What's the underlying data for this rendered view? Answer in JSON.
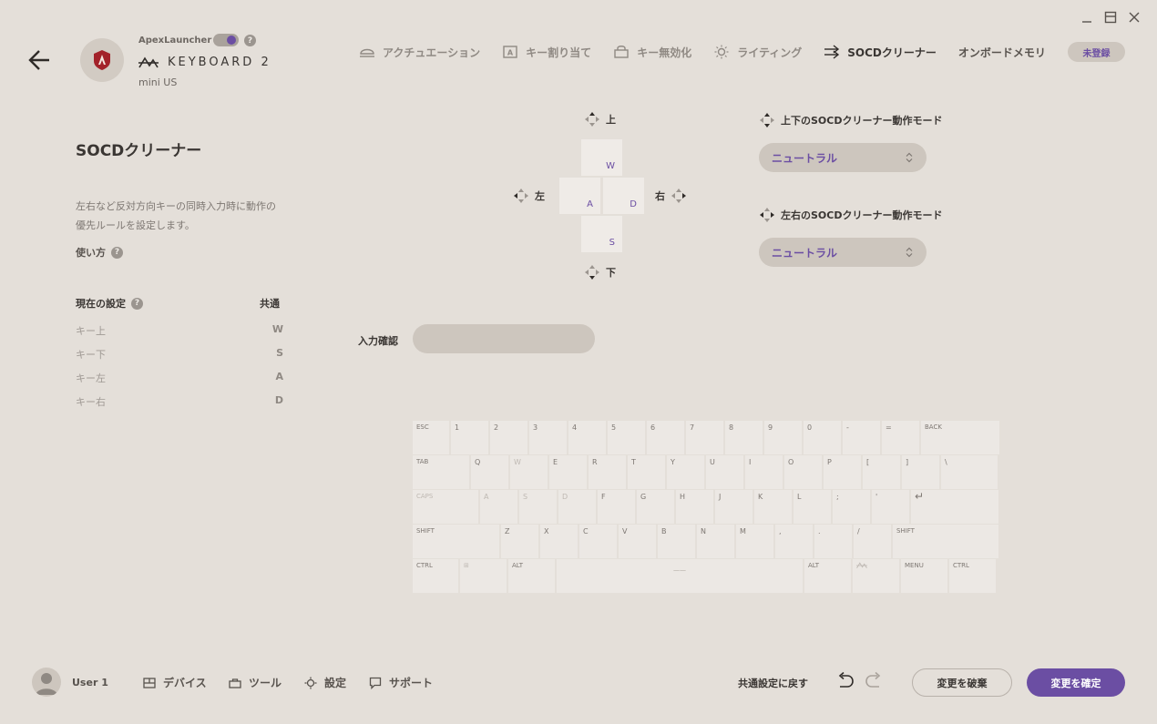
{
  "window": {
    "minimize_icon": "minimize-icon",
    "maximize_icon": "maximize-icon",
    "close_icon": "close-icon"
  },
  "device": {
    "app_name": "ApexLauncher",
    "sync_enabled": true,
    "brand_name": "KEYBOARD 2",
    "model": "mini US"
  },
  "tabs": [
    {
      "label": "アクチュエーション",
      "icon": "actuation-icon"
    },
    {
      "label": "キー割り当て",
      "icon": "key-assign-icon"
    },
    {
      "label": "キー無効化",
      "icon": "key-disable-icon"
    },
    {
      "label": "ライティング",
      "icon": "lighting-icon"
    },
    {
      "label": "SOCDクリーナー",
      "icon": "socd-icon",
      "active": true
    },
    {
      "label": "オンボードメモリ",
      "icon": ""
    }
  ],
  "badge": "未登録",
  "left": {
    "title": "SOCDクリーナー",
    "description": "左右など反対方向キーの同時入力時に動作の優先ルールを設定します。",
    "howto": "使い方",
    "current_title": "現在の設定",
    "current_profile": "共通",
    "settings": [
      {
        "label": "キー上",
        "value": "W"
      },
      {
        "label": "キー下",
        "value": "S"
      },
      {
        "label": "キー左",
        "value": "A"
      },
      {
        "label": "キー右",
        "value": "D"
      }
    ]
  },
  "diagram": {
    "up": "上",
    "down": "下",
    "left": "左",
    "right": "右",
    "keys": {
      "up": "W",
      "left": "A",
      "right": "D",
      "down": "S"
    }
  },
  "modes": {
    "vertical_label": "上下のSOCDクリーナー動作モード",
    "vertical_value": "ニュートラル",
    "horizontal_label": "左右のSOCDクリーナー動作モード",
    "horizontal_value": "ニュートラル"
  },
  "input_confirm": {
    "label": "入力確認",
    "value": ""
  },
  "keyboard": {
    "row1": [
      "ESC",
      "1",
      "2",
      "3",
      "4",
      "5",
      "6",
      "7",
      "8",
      "9",
      "0",
      "-",
      "=",
      "BACK"
    ],
    "row2": [
      "TAB",
      "Q",
      "W",
      "E",
      "R",
      "T",
      "Y",
      "U",
      "I",
      "O",
      "P",
      "[",
      "]",
      "\\"
    ],
    "row3": [
      "CAPS",
      "A",
      "S",
      "D",
      "F",
      "G",
      "H",
      "J",
      "K",
      "L",
      ";",
      "'",
      "↵"
    ],
    "row4": [
      "SHIFT",
      "Z",
      "X",
      "C",
      "V",
      "B",
      "N",
      "M",
      ",",
      ".",
      "/",
      "SHIFT"
    ],
    "row5": [
      "CTRL",
      "⊞",
      "ALT",
      "——",
      "ALT",
      "",
      "MENU",
      "CTRL"
    ]
  },
  "bottom": {
    "user": "User 1",
    "nav": [
      {
        "label": "デバイス",
        "icon": "device-icon"
      },
      {
        "label": "ツール",
        "icon": "tool-icon"
      },
      {
        "label": "設定",
        "icon": "gear-icon"
      },
      {
        "label": "サポート",
        "icon": "chat-icon"
      }
    ],
    "reset": "共通設定に戻す",
    "discard": "変更を破棄",
    "confirm": "変更を確定"
  },
  "colors": {
    "accent": "#6b4ea3",
    "background": "#e4dfd9",
    "control": "#cdc6be",
    "key": "#efebe7"
  }
}
